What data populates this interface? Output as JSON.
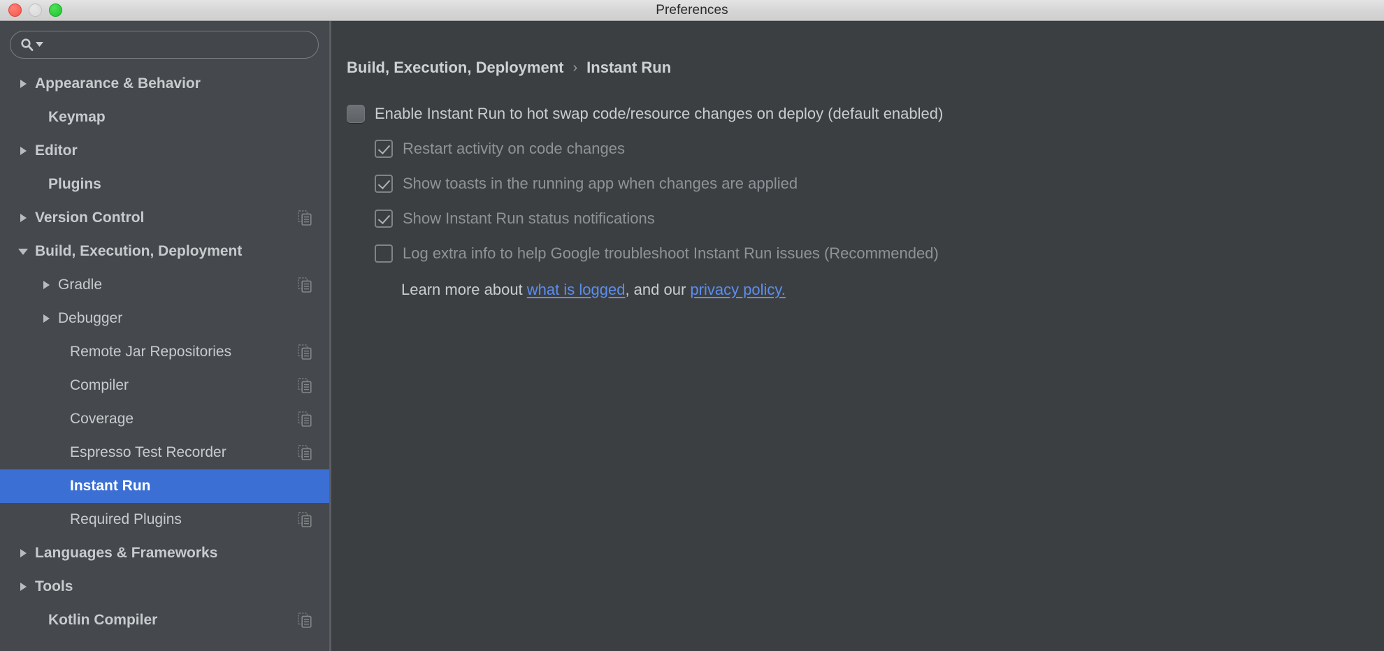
{
  "window": {
    "title": "Preferences",
    "controls": [
      {
        "name": "close-button",
        "color": "#f4564c"
      },
      {
        "name": "minimize-button",
        "color": "#d8d8d8"
      },
      {
        "name": "maximize-button",
        "color": "#1fc42e"
      }
    ]
  },
  "search": {
    "value": "",
    "placeholder": "",
    "icon": "search-icon",
    "dropdown_icon": "chevron-down-icon"
  },
  "sidebar": {
    "selected": "Instant Run",
    "items": [
      {
        "label": "Appearance & Behavior",
        "depth": 0,
        "arrow": "right",
        "bold": true,
        "copy_icon": false
      },
      {
        "label": "Keymap",
        "depth": 0,
        "arrow": "none",
        "bold": true,
        "copy_icon": false
      },
      {
        "label": "Editor",
        "depth": 0,
        "arrow": "right",
        "bold": true,
        "copy_icon": false
      },
      {
        "label": "Plugins",
        "depth": 0,
        "arrow": "none",
        "bold": true,
        "copy_icon": false
      },
      {
        "label": "Version Control",
        "depth": 0,
        "arrow": "right",
        "bold": true,
        "copy_icon": true
      },
      {
        "label": "Build, Execution, Deployment",
        "depth": 0,
        "arrow": "down",
        "bold": true,
        "copy_icon": false
      },
      {
        "label": "Gradle",
        "depth": 1,
        "arrow": "right",
        "bold": false,
        "copy_icon": true
      },
      {
        "label": "Debugger",
        "depth": 1,
        "arrow": "right",
        "bold": false,
        "copy_icon": false
      },
      {
        "label": "Remote Jar Repositories",
        "depth": 1,
        "arrow": "none",
        "bold": false,
        "copy_icon": true
      },
      {
        "label": "Compiler",
        "depth": 1,
        "arrow": "none",
        "bold": false,
        "copy_icon": true
      },
      {
        "label": "Coverage",
        "depth": 1,
        "arrow": "none",
        "bold": false,
        "copy_icon": true
      },
      {
        "label": "Espresso Test Recorder",
        "depth": 1,
        "arrow": "none",
        "bold": false,
        "copy_icon": true
      },
      {
        "label": "Instant Run",
        "depth": 1,
        "arrow": "none",
        "bold": true,
        "copy_icon": false,
        "selected": true
      },
      {
        "label": "Required Plugins",
        "depth": 1,
        "arrow": "none",
        "bold": false,
        "copy_icon": true
      },
      {
        "label": "Languages & Frameworks",
        "depth": 0,
        "arrow": "right",
        "bold": true,
        "copy_icon": false
      },
      {
        "label": "Tools",
        "depth": 0,
        "arrow": "right",
        "bold": true,
        "copy_icon": false
      },
      {
        "label": "Kotlin Compiler",
        "depth": 0,
        "arrow": "none",
        "bold": true,
        "copy_icon": true
      }
    ]
  },
  "panel": {
    "breadcrumb": {
      "parent": "Build, Execution, Deployment",
      "separator": "›",
      "current": "Instant Run"
    },
    "options": [
      {
        "label": "Enable Instant Run to hot swap code/resource changes on deploy (default enabled)",
        "checked": false,
        "disabled": false,
        "indent": false,
        "style": "filled-empty"
      },
      {
        "label": "Restart activity on code changes",
        "checked": true,
        "disabled": true,
        "indent": true,
        "style": "ghost-checked"
      },
      {
        "label": "Show toasts in the running app when changes are applied",
        "checked": true,
        "disabled": true,
        "indent": true,
        "style": "ghost-checked"
      },
      {
        "label": "Show Instant Run status notifications",
        "checked": true,
        "disabled": true,
        "indent": true,
        "style": "ghost-checked"
      },
      {
        "label": "Log extra info to help Google troubleshoot Instant Run issues (Recommended)",
        "checked": false,
        "disabled": true,
        "indent": true,
        "style": "ghost"
      }
    ],
    "learn_more": {
      "prefix": "Learn more about ",
      "link1": "what is logged",
      "middle": ", and our ",
      "link2": "privacy policy.",
      "suffix": ""
    }
  },
  "colors": {
    "selection_blue": "#3b6fd4",
    "link_blue": "#5b8ef0",
    "sidebar_bg": "#45484c",
    "panel_bg": "#3c3f41",
    "titlebar_bg": "#d6d6d6"
  }
}
